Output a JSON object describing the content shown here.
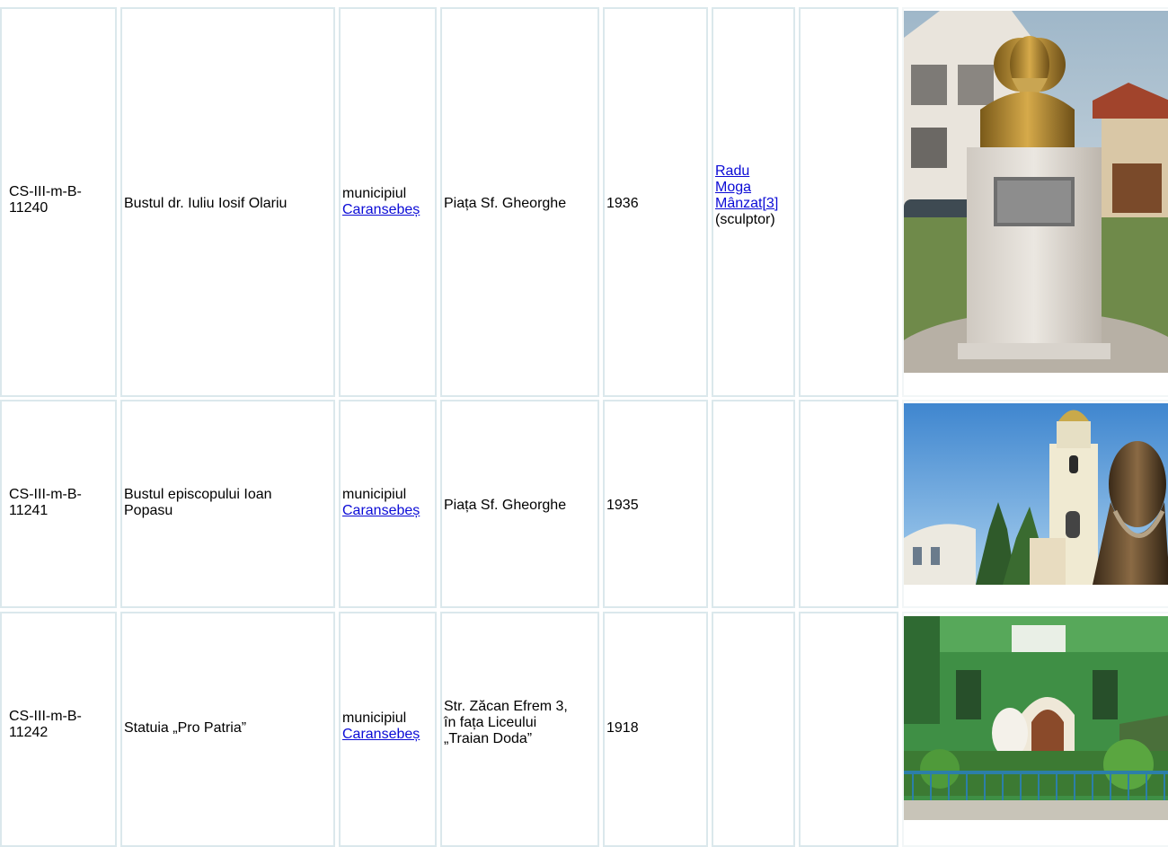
{
  "rows": [
    {
      "code": [
        "CS-III-m-B-",
        "11240"
      ],
      "name": [
        "Bustul dr. Iuliu Iosif Olariu"
      ],
      "locality_prefix": "municipiul",
      "locality_link": "Caransebeș",
      "address": [
        "Piața Sf. Gheorghe"
      ],
      "year": "1936",
      "author_links": [
        "Radu ",
        "Moga ",
        "Mânzat[3]"
      ],
      "author_role": "(sculptor)"
    },
    {
      "code": [
        "CS-III-m-B-",
        "11241"
      ],
      "name": [
        "Bustul episcopului Ioan",
        "Popasu"
      ],
      "locality_prefix": "municipiul",
      "locality_link": "Caransebeș",
      "address": [
        "Piața Sf. Gheorghe"
      ],
      "year": "1935",
      "author_links": [],
      "author_role": ""
    },
    {
      "code": [
        "CS-III-m-B-",
        "11242"
      ],
      "name": [
        "Statuia „Pro Patria”"
      ],
      "locality_prefix": "municipiul",
      "locality_link": "Caransebeș",
      "address": [
        "Str. Zăcan Efrem 3,",
        "în fața Liceului",
        "„Traian Doda”"
      ],
      "year": "1918",
      "author_links": [],
      "author_role": ""
    }
  ]
}
